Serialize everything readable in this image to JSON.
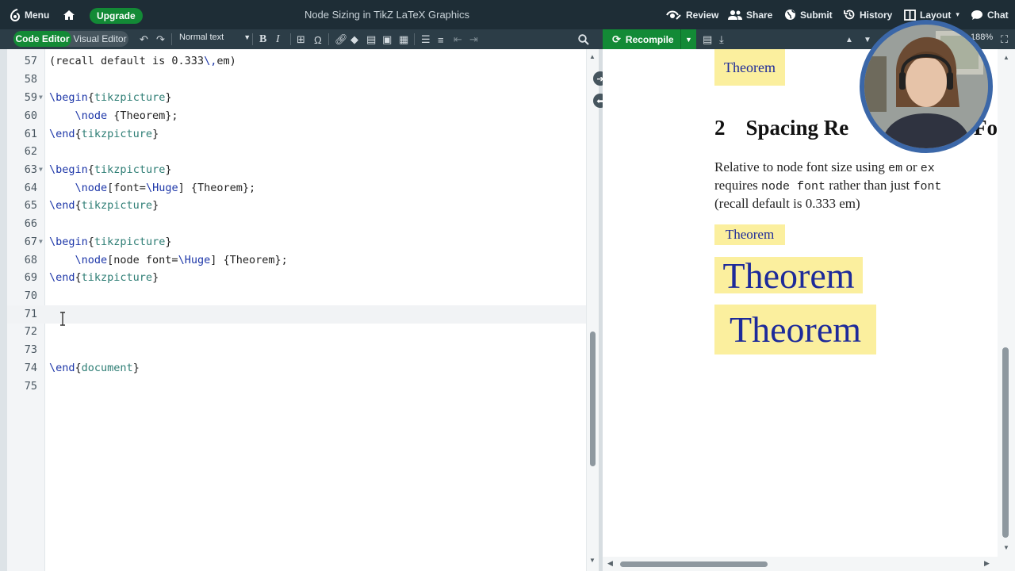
{
  "topbar": {
    "menu_label": "Menu",
    "upgrade_label": "Upgrade",
    "doc_title": "Node Sizing in TikZ LaTeX Graphics",
    "review_label": "Review",
    "share_label": "Share",
    "submit_label": "Submit",
    "history_label": "History",
    "layout_label": "Layout",
    "chat_label": "Chat"
  },
  "toolbar": {
    "code_editor_label": "Code Editor",
    "visual_editor_label": "Visual Editor",
    "style_select_value": "Normal text",
    "recompile_label": "Recompile",
    "zoom_label": "188%"
  },
  "editor": {
    "lines": [
      {
        "num": "57",
        "text": "(recall default is 0.333\\,em)"
      },
      {
        "num": "58",
        "text": ""
      },
      {
        "num": "59",
        "text": "\\begin{tikzpicture}"
      },
      {
        "num": "60",
        "text": "    \\node {Theorem};"
      },
      {
        "num": "61",
        "text": "\\end{tikzpicture}"
      },
      {
        "num": "62",
        "text": ""
      },
      {
        "num": "63",
        "text": "\\begin{tikzpicture}"
      },
      {
        "num": "64",
        "text": "    \\node[font=\\Huge] {Theorem};"
      },
      {
        "num": "65",
        "text": "\\end{tikzpicture}"
      },
      {
        "num": "66",
        "text": ""
      },
      {
        "num": "67",
        "text": "\\begin{tikzpicture}"
      },
      {
        "num": "68",
        "text": "    \\node[node font=\\Huge] {Theorem};"
      },
      {
        "num": "69",
        "text": "\\end{tikzpicture}"
      },
      {
        "num": "70",
        "text": ""
      },
      {
        "num": "71",
        "text": ""
      },
      {
        "num": "72",
        "text": ""
      },
      {
        "num": "73",
        "text": ""
      },
      {
        "num": "74",
        "text": "\\end{document}"
      },
      {
        "num": "75",
        "text": ""
      }
    ]
  },
  "preview": {
    "theorem_top": "Theorem",
    "section_number": "2",
    "section_title": "Spacing Re",
    "section_title_tail": "Fo",
    "para_line1_a": "Relative to node font size using ",
    "para_line1_b": "em",
    "para_line1_c": " or ",
    "para_line1_d": "ex",
    "para_line2_a": "requires ",
    "para_line2_b": "node font",
    "para_line2_c": " rather than just ",
    "para_line2_d": "font",
    "para_line3": "(recall default is 0.333 em)",
    "theorem_small": "Theorem",
    "theorem_huge1": "Theorem",
    "theorem_huge2": "Theorem"
  }
}
